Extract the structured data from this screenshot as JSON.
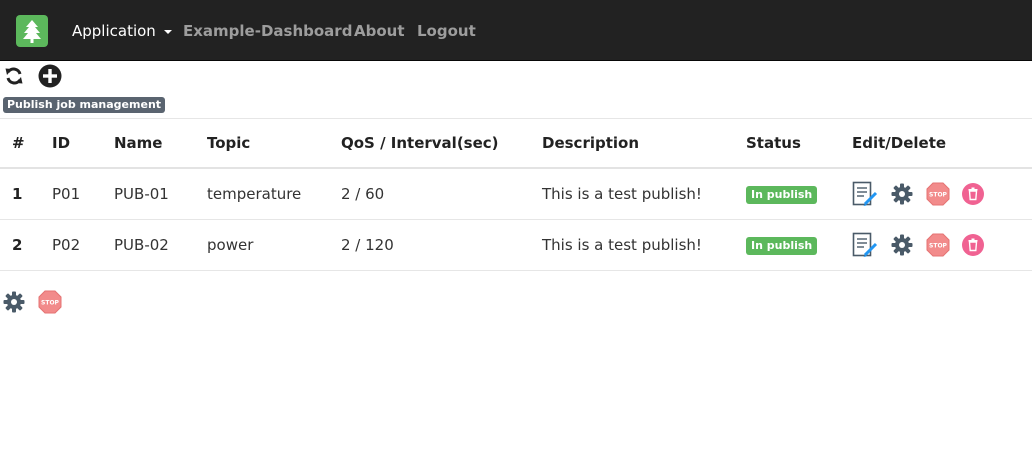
{
  "nav": {
    "brand_icon": "tree-icon",
    "items": [
      {
        "label": "Application",
        "dropdown": true,
        "active": true
      },
      {
        "label": "Example-Dashboard"
      },
      {
        "label": "About"
      },
      {
        "label": "Logout"
      }
    ]
  },
  "toolbar": {
    "refresh_icon": "refresh-icon",
    "add_icon": "plus-circle-icon",
    "tooltip": "Publish job management"
  },
  "table": {
    "headers": [
      "#",
      "ID",
      "Name",
      "Topic",
      "QoS / Interval(sec)",
      "Description",
      "Status",
      "Edit/Delete"
    ],
    "rows": [
      {
        "index": "1",
        "id": "P01",
        "name": "PUB-01",
        "topic": "temperature",
        "qos_interval": "2 / 60",
        "description": "This is a test publish!",
        "status": "In publish"
      },
      {
        "index": "2",
        "id": "P02",
        "name": "PUB-02",
        "topic": "power",
        "qos_interval": "2 / 120",
        "description": "This is a test publish!",
        "status": "In publish"
      }
    ],
    "row_actions": [
      "edit-icon",
      "settings-icon",
      "stop-icon",
      "delete-icon"
    ]
  },
  "stop_label": "STOP",
  "bottom_actions": [
    "settings-icon",
    "stop-icon"
  ],
  "colors": {
    "navbar": "#222222",
    "brand": "#5cb85c",
    "status_badge": "#5cb85c",
    "stop": "#f28b8b",
    "delete": "#f06292",
    "gear": "#4a5a68"
  }
}
